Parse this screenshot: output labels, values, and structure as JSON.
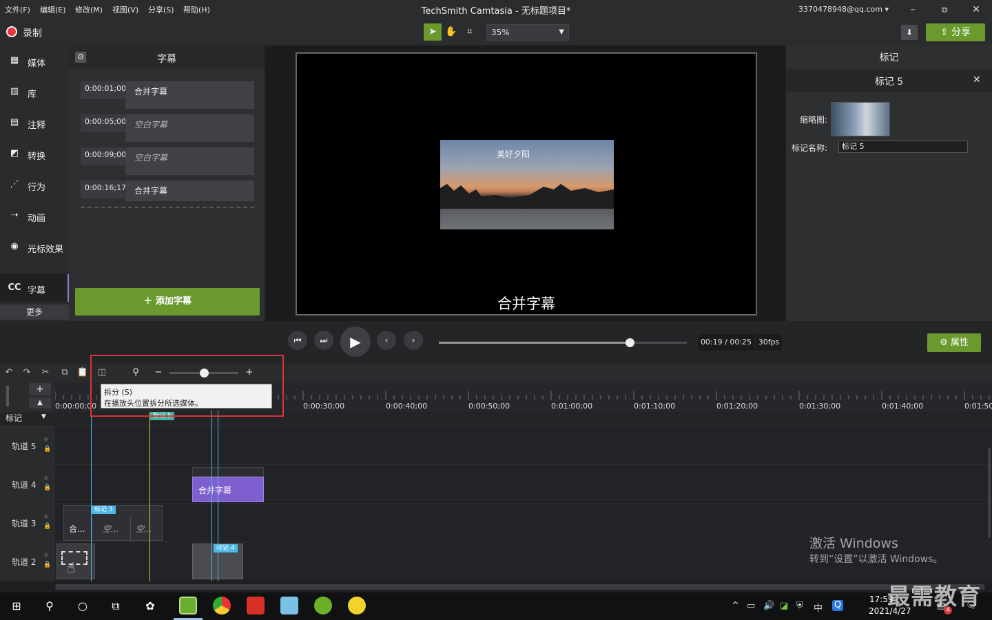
{
  "menu": [
    "文件(F)",
    "编辑(E)",
    "修改(M)",
    "视图(V)",
    "分享(S)",
    "帮助(H)"
  ],
  "window": {
    "title": "TechSmith Camtasia - 无标题项目*",
    "account": "3370478948@qq.com"
  },
  "toolbar": {
    "record_label": "录制",
    "zoom": "35%",
    "share_label": "分享"
  },
  "sidebar": {
    "items": [
      {
        "label": "媒体",
        "icon": "media-icon"
      },
      {
        "label": "库",
        "icon": "library-icon"
      },
      {
        "label": "注释",
        "icon": "annotation-icon"
      },
      {
        "label": "转换",
        "icon": "transition-icon"
      },
      {
        "label": "行为",
        "icon": "behavior-icon"
      },
      {
        "label": "动画",
        "icon": "animation-icon"
      },
      {
        "label": "光标效果",
        "icon": "cursor-effect-icon"
      }
    ],
    "cc": {
      "prefix": "CC",
      "label": "字幕"
    },
    "more": "更多"
  },
  "captions": {
    "title": "字幕",
    "items": [
      {
        "time": "0:00:01;00",
        "text": "合并字幕",
        "empty": false
      },
      {
        "time": "0:00:05;00",
        "text": "空白字幕",
        "empty": true
      },
      {
        "time": "0:00:09;00",
        "text": "空白字幕",
        "empty": true
      },
      {
        "time": "0:00:16;17",
        "text": "合并字幕",
        "empty": false
      }
    ],
    "add_button": "添加字幕"
  },
  "canvas": {
    "photo_caption": "美好夕阳",
    "caption": "合并字幕"
  },
  "properties": {
    "title": "标记",
    "subtitle": "标记 5",
    "thumb_label": "缩略图:",
    "name_label": "标记名称:",
    "name_value": "标记 5"
  },
  "playback": {
    "time": "00:19 / 00:25",
    "fps": "30fps",
    "progress": 0.77,
    "props_button": "属性"
  },
  "timeline": {
    "zoom_level": 0.5,
    "tooltip_title": "拆分 (S)",
    "tooltip_desc": "在播放头位置拆分所选媒体。",
    "ruler_labels": [
      "0:00:00;00",
      "0:00:30;00",
      "0:00:40;00",
      "0:00:50;00",
      "0:01:00;00",
      "0:01:10;00",
      "0:01:20;00",
      "0:01:30;00",
      "0:01:40;00",
      "0:01:50;"
    ],
    "marker_row_label": "标记",
    "tracks": [
      "轨道 5",
      "轨道 4",
      "轨道 3",
      "轨道 2"
    ],
    "clip_track4": "合并字幕",
    "clip_track3": [
      "合...",
      "空...",
      "空..."
    ],
    "markers": [
      "标记 3",
      "标记 4",
      "标记 5"
    ]
  },
  "activation": {
    "line1": "激活 Windows",
    "line2": "转到“设置”以激活 Windows。"
  },
  "taskbar": {
    "time": "17:59",
    "date": "2021/4/27",
    "ime": "中",
    "brand": "最需教育",
    "notif_count": "4"
  }
}
